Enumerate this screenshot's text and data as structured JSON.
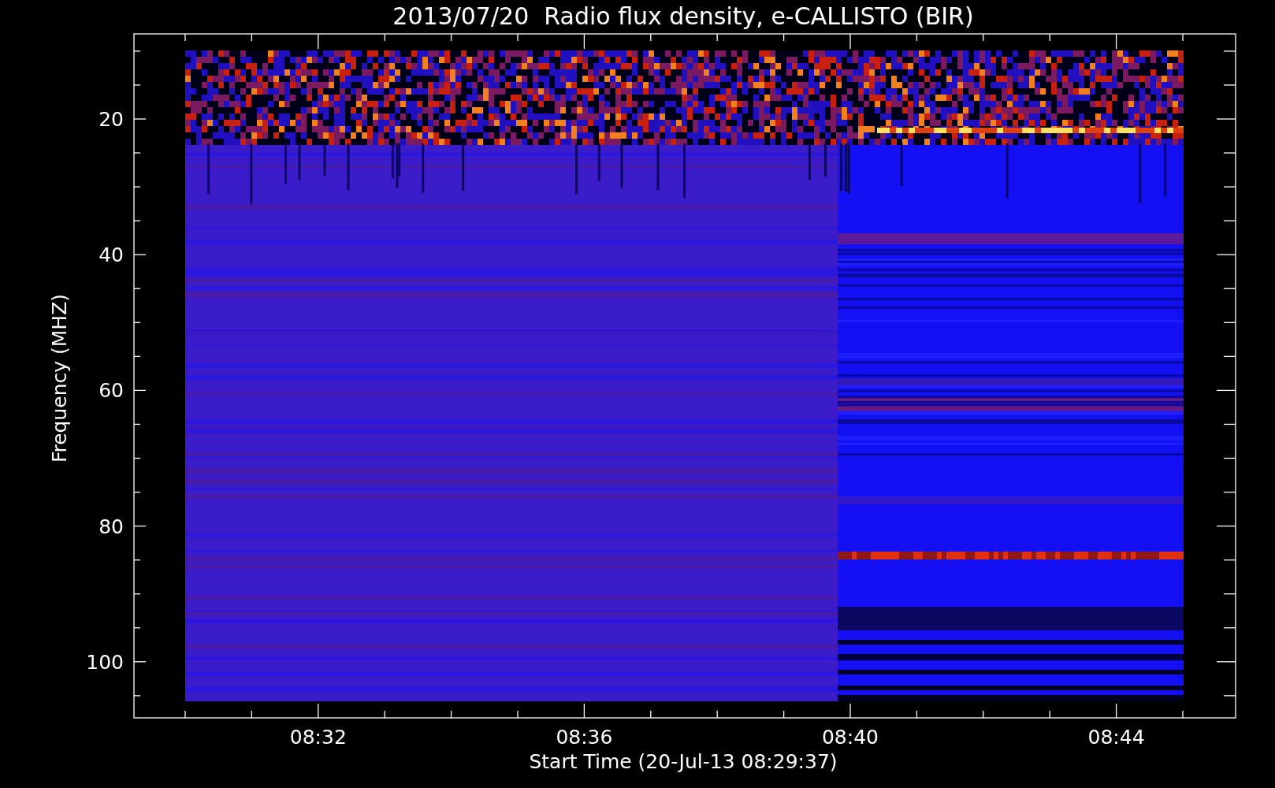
{
  "title": "2013/07/20  Radio flux density, e-CALLISTO (BIR)",
  "y_axis": {
    "label": "Frequency (MHZ)",
    "tick_labels": [
      "20",
      "40",
      "60",
      "80",
      "100"
    ]
  },
  "x_axis": {
    "label": "Start Time (20-Jul-13 08:29:37)",
    "tick_labels": [
      "08:32",
      "08:36",
      "08:40",
      "08:44"
    ]
  },
  "spectrogram": {
    "kind": "spectrogram"
  }
}
